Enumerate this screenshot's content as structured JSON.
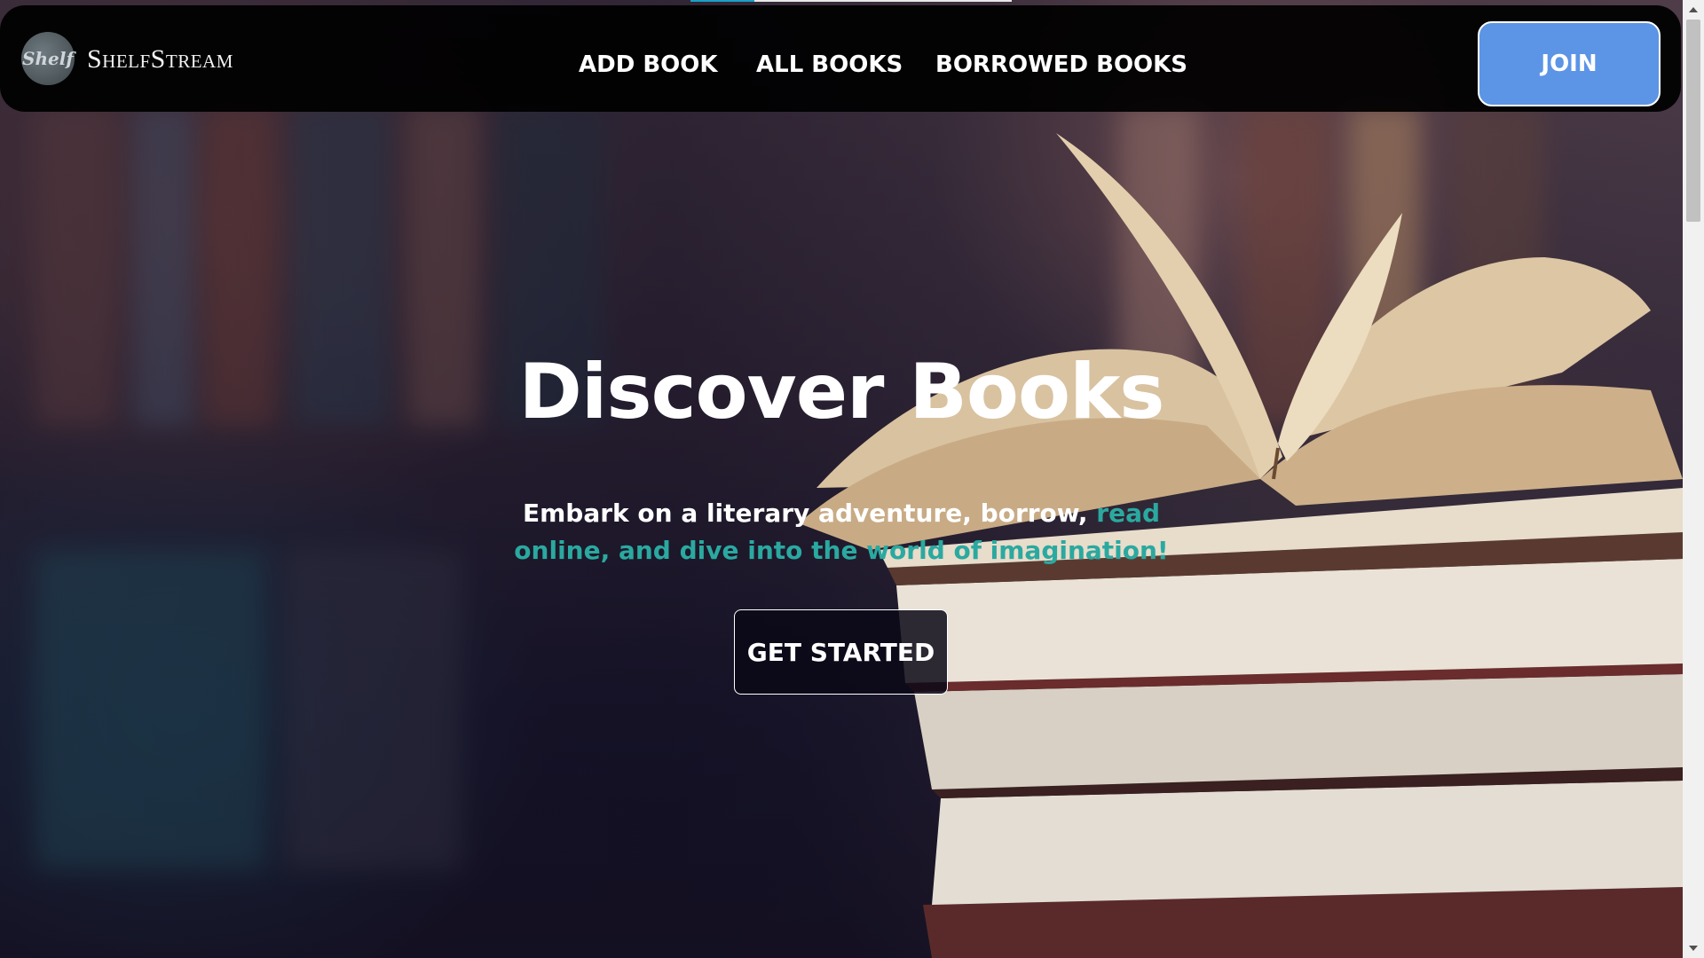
{
  "brand": {
    "name": "ShelfStream",
    "badge_text": "Shelf"
  },
  "nav": {
    "links": [
      "ADD BOOK",
      "ALL BOOKS",
      "BORROWED BOOKS"
    ],
    "join_label": "JOIN"
  },
  "hero": {
    "title": "Discover Books",
    "subtitle_white": "Embark on a literary adventure, borrow, ",
    "subtitle_accent": "read online, and dive into the world of imagination!",
    "cta_label": "GET STARTED"
  },
  "colors": {
    "accent": "#2aa9a0",
    "join_button": "#5c94e6",
    "navbar": "#000000",
    "progress": "#1aa0c8"
  },
  "icons": {
    "scroll_up": "triangle-up",
    "scroll_down": "triangle-down"
  }
}
